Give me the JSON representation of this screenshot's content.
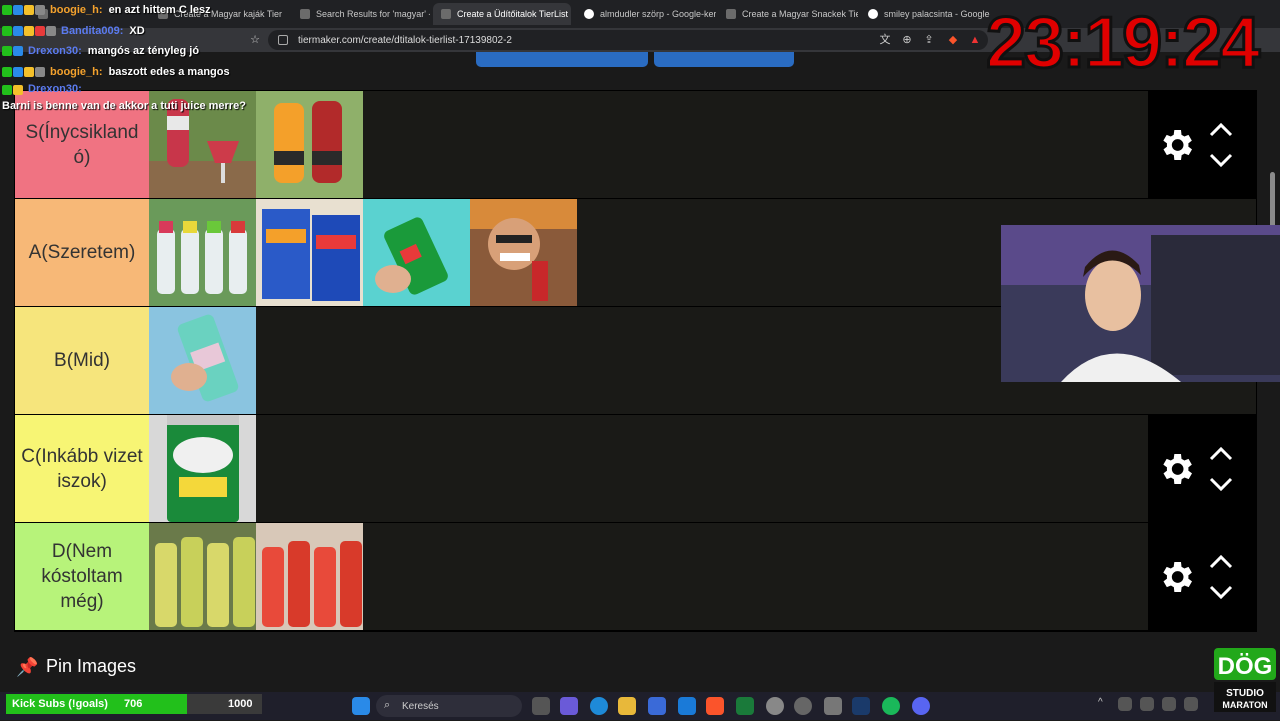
{
  "browser": {
    "tabs": [
      {
        "label": "boogie_h: en azt hittem C lesz",
        "active": false
      },
      {
        "label": "Create a Magyar kaják Tier List",
        "active": false
      },
      {
        "label": "Search Results for 'magyar' - T",
        "active": false
      },
      {
        "label": "Create a Üdítőitalok TierList",
        "active": true
      },
      {
        "label": "almdudler szörp - Google-kere",
        "active": false
      },
      {
        "label": "Create a Magyar Snackek Tier",
        "active": false
      },
      {
        "label": "smiley palacsinta - Google-kere",
        "active": false
      }
    ],
    "url": "tiermaker.com/create/dtitalok-tierlist-17139802-2"
  },
  "tiers": [
    {
      "label": "S(Ínycsikland ó)",
      "color": "#f07382",
      "items": [
        "rasperry-drink",
        "cappy-bottles"
      ]
    },
    {
      "label": "A(Szeretem)",
      "color": "#f7b877",
      "items": [
        "fruit-water-bottles",
        "capri-sun",
        "7up-can",
        "man-with-drink"
      ]
    },
    {
      "label": "B(Mid)",
      "color": "#f6e57c",
      "items": [
        "arizona-can"
      ]
    },
    {
      "label": "C(Inkább vizet iszok)",
      "color": "#f7f574",
      "items": [
        "canada-dry-can"
      ]
    },
    {
      "label": "D(Nem kóstoltam még)",
      "color": "#b7f37a",
      "items": [
        "almdudler-bottles",
        "red-soda-bottles"
      ]
    }
  ],
  "pin_section": {
    "label": "Pin Images"
  },
  "overlay": {
    "clock": "23:19:24",
    "chat": [
      {
        "user": "boogie_h:",
        "message": "en azt hittem C lesz",
        "user_color": "#f4a22d"
      },
      {
        "user": "Bandita009:",
        "message": "XD",
        "user_color": "#5b7bf0"
      },
      {
        "user": "Drexon30:",
        "message": "mangós az tényleg jó",
        "user_color": "#5b7bf0"
      },
      {
        "user": "boogie_h:",
        "message": "baszott edes a mangos",
        "user_color": "#f4a22d"
      },
      {
        "user": "Drexon30:",
        "message": "Barni is benne van de akkor a tuti juice merre?",
        "user_color": "#5b7bf0"
      }
    ],
    "subs_goal": {
      "label": "Kick Subs (!goals)",
      "current": "706",
      "goal": "1000",
      "progress": 0.706
    }
  },
  "taskbar": {
    "search_placeholder": "Keresés"
  }
}
